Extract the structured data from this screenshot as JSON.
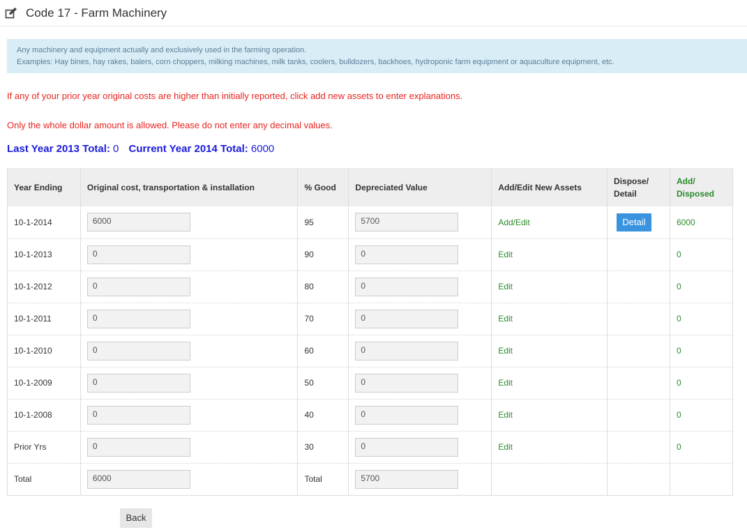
{
  "header": {
    "icon": "edit-icon",
    "title": "Code 17 - Farm Machinery"
  },
  "info": {
    "line1": "Any machinery and equipment actually and exclusively used in the farming operation.",
    "line2": "Examples: Hay bines, hay rakes, balers, corn choppers, milking machines, milk tanks, coolers, bulldozers, backhoes, hydroponic farm equipment or aquaculture equipment, etc."
  },
  "warnings": {
    "prior_costs": "If any of your prior year original costs are higher than initially reported, click add new assets to enter explanations.",
    "whole_dollar": "Only the whole dollar amount is allowed. Please do not enter any decimal values."
  },
  "totals": {
    "last_label": "Last Year 2013 Total:",
    "last_value": "0",
    "current_label": "Current Year 2014 Total:",
    "current_value": "6000"
  },
  "table": {
    "headers": {
      "year": "Year Ending",
      "cost": "Original cost, transportation & installation",
      "good": "% Good",
      "depr": "Depreciated Value",
      "add_edit": "Add/Edit New Assets",
      "dispose_1": "Dispose/",
      "dispose_2": "Detail",
      "added_1": "Add/",
      "added_2": "Disposed"
    },
    "rows": [
      {
        "year": "10-1-2014",
        "cost": "6000",
        "good": "95",
        "depr": "5700",
        "link": "Add/Edit",
        "detail": "Detail",
        "added": "6000"
      },
      {
        "year": "10-1-2013",
        "cost": "0",
        "good": "90",
        "depr": "0",
        "link": "Edit",
        "added": "0"
      },
      {
        "year": "10-1-2012",
        "cost": "0",
        "good": "80",
        "depr": "0",
        "link": "Edit",
        "added": "0"
      },
      {
        "year": "10-1-2011",
        "cost": "0",
        "good": "70",
        "depr": "0",
        "link": "Edit",
        "added": "0"
      },
      {
        "year": "10-1-2010",
        "cost": "0",
        "good": "60",
        "depr": "0",
        "link": "Edit",
        "added": "0"
      },
      {
        "year": "10-1-2009",
        "cost": "0",
        "good": "50",
        "depr": "0",
        "link": "Edit",
        "added": "0"
      },
      {
        "year": "10-1-2008",
        "cost": "0",
        "good": "40",
        "depr": "0",
        "link": "Edit",
        "added": "0"
      },
      {
        "year": "Prior Yrs",
        "cost": "0",
        "good": "30",
        "depr": "0",
        "link": "Edit",
        "added": "0"
      }
    ],
    "total_row": {
      "label": "Total",
      "cost": "6000",
      "good_label": "Total",
      "depr": "5700"
    }
  },
  "buttons": {
    "back": "Back"
  },
  "colors": {
    "info_bg": "#d9edf7",
    "warning": "#e8231f",
    "totals": "#1a1adb",
    "link_green": "#2a8a2a",
    "detail_button": "#3a93df"
  }
}
